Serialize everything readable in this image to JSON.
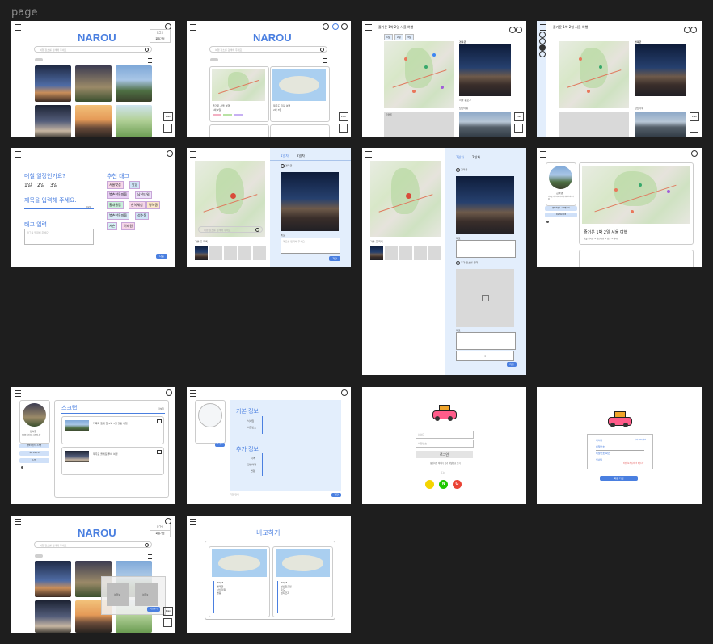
{
  "canvas": {
    "label": "page"
  },
  "common": {
    "logo": "NAROU",
    "search_placeholder": "여행 장소를 검색해 주세요",
    "side_btn_1": "로그인",
    "side_btn_2": "회원가입",
    "plan_btn": "Plan"
  },
  "frame2": {
    "card1_title": "즐거운 서울 여행",
    "card1_sub": "1박 2일",
    "card2_title": "제주도 힐링 여행",
    "card2_sub": "2박 3일"
  },
  "frame3": {
    "title": "즐거운 1박 2일 서울 여행",
    "chips": [
      "1일",
      "2일",
      "3일"
    ],
    "side_title": "경복궁",
    "side_sub": "서울 종로구",
    "label2": "남산타워",
    "label3": "코멘트"
  },
  "frame4": {
    "title": "즐거운 1박 2일 서울 여행",
    "side_title": "경복궁",
    "label2": "남산타워"
  },
  "frame5": {
    "question": "며칠 일정인가요?",
    "days": [
      "1일",
      "2일",
      "3일"
    ],
    "title_prompt": "제목을 입력해 주세요.",
    "char_count": "0/20",
    "tag_input_label": "태그 입력",
    "tag_input_placeholder": "태그를 입력해 주세요",
    "recommend_title": "추천 태그",
    "tags": [
      "서울맛집",
      "맛집",
      "북촌한옥마을",
      "남산타워",
      "홍대클럽",
      "한복체험",
      "경복궁",
      "북촌한옥마을",
      "성수동",
      "서촌",
      "이태원"
    ],
    "done": "다음"
  },
  "frame6": {
    "tab1": "1일차",
    "tab2": "2일차",
    "place": "경복궁",
    "memo_label": "메모",
    "memo_placeholder": "메모를 입력해 주세요",
    "list_label": "가볼 곳 목록",
    "save": "저장"
  },
  "frame7": {
    "tab1": "1일차",
    "tab2": "2일차",
    "place1": "경복궁",
    "place2": "추가 장소를 입력",
    "memo_label": "메모",
    "memo_label2": "메모",
    "list_label": "가볼 곳 목록",
    "add": "+",
    "save": "저장"
  },
  "frame8": {
    "username": "김여행",
    "bio": "여행을 사랑하는 사람입니다 함께 떠나요",
    "btn1": "플랜 만들기 / 스크랩 보기",
    "btn2": "회원 정보 수정",
    "trip_title": "즐거운 1박 2일 서울 여행",
    "trip_sub": "서울 경복궁 → 남산타워 → 명동 → 홍대"
  },
  "frame9": {
    "username": "김여행",
    "bio": "여행을 사랑하는 사람입니다",
    "btn1": "플랜 만들기 / 스크랩",
    "btn2": "회원 정보 수정",
    "btn3": "스크랩",
    "section": "스크랩",
    "more": "더보기",
    "item1": "가족과 함께 한 2박 3일 힐링 여행",
    "item2": "제주도 올레길 투어 여행"
  },
  "frame10": {
    "basic_title": "기본 정보",
    "fields1": [
      "닉네임",
      "비밀번호"
    ],
    "extra_title": "추가 정보",
    "fields2": [
      "지역",
      "관심여행",
      "연령"
    ],
    "upload": "사진 업로드",
    "save": "저장",
    "hint": "회원 탈퇴"
  },
  "frame11": {
    "id_placeholder": "아이디",
    "pw_placeholder": "비밀번호",
    "login": "로그인",
    "links": "회원가입  아이디 찾기  비밀번호 찾기",
    "or": "또는",
    "socials": [
      "",
      "N",
      "G"
    ],
    "social_colors": [
      "#f4d400",
      "#1ec800",
      "#ea4335"
    ]
  },
  "frame12": {
    "rows": [
      "아이디",
      "비밀번호",
      "비밀번호 확인",
      "닉네임"
    ],
    "check": "아이디 중복 확인",
    "error": "비밀번호가 일치하지 않습니다",
    "submit": "회원 가입"
  },
  "frame13": {
    "overlay_btn": "비교하기",
    "thumb1": "여행1",
    "thumb2": "여행2"
  },
  "frame14": {
    "title": "비교하기",
    "col1_day": "Day1",
    "col1_items": [
      "경복궁",
      "남산타워",
      "명동"
    ],
    "col2_day": "Day1",
    "col2_items": [
      "성산일출봉",
      "우도",
      "섭지코지"
    ]
  },
  "colors": {
    "brand": "#4a7fe0",
    "canvas": "#1e1e1e",
    "panel": "#e3eefc"
  }
}
